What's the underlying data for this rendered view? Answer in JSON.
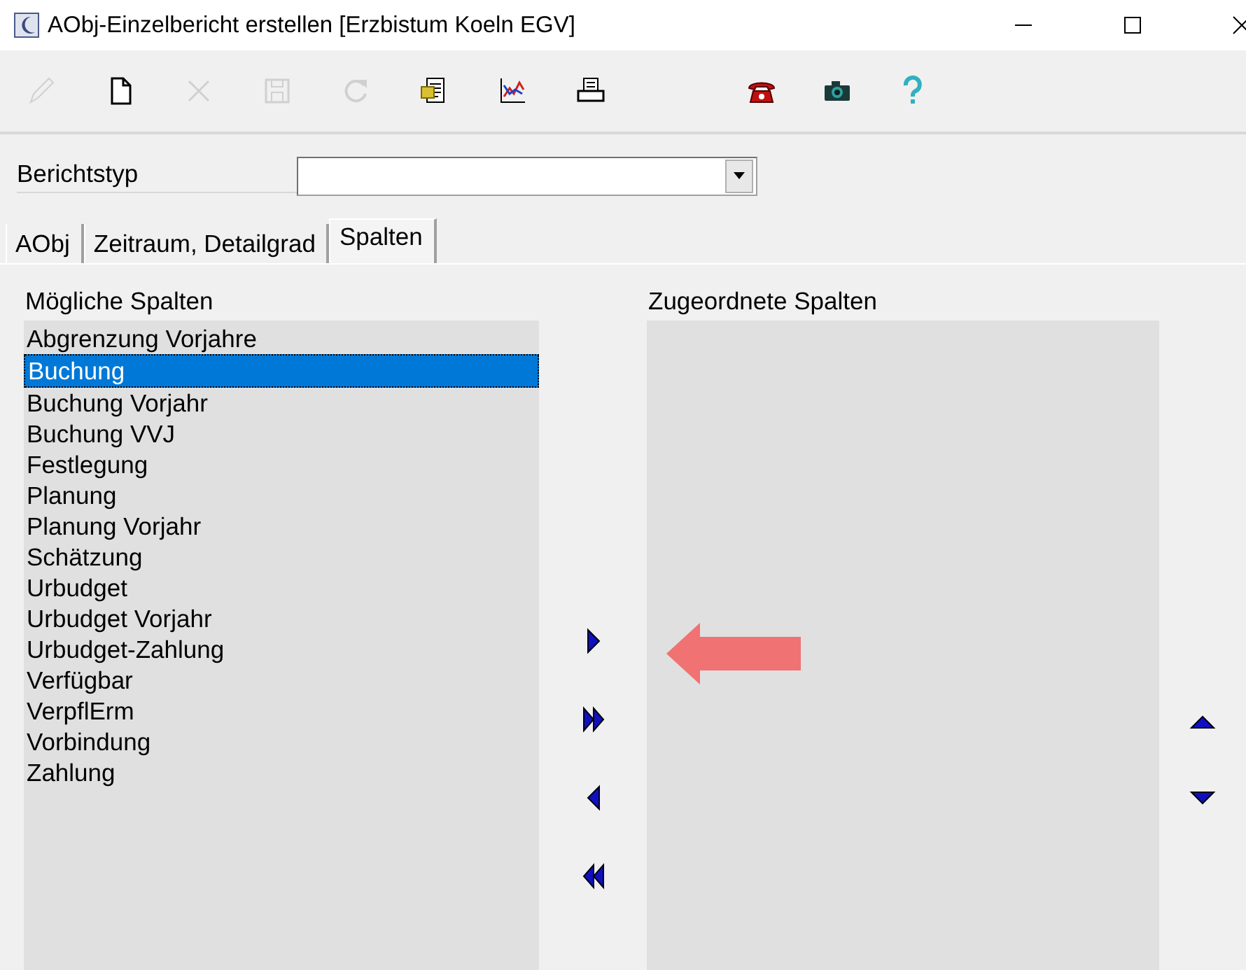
{
  "window": {
    "title": "AObj-Einzelbericht erstellen [Erzbistum Koeln EGV]"
  },
  "toolbar": [
    {
      "kind": "pencil",
      "disabled": true
    },
    {
      "kind": "new",
      "disabled": false
    },
    {
      "kind": "delete",
      "disabled": true
    },
    {
      "kind": "save",
      "disabled": true
    },
    {
      "kind": "refresh",
      "disabled": true
    },
    {
      "kind": "report",
      "disabled": false
    },
    {
      "kind": "chart",
      "disabled": false
    },
    {
      "kind": "print",
      "disabled": false
    }
  ],
  "toolbar_right": [
    {
      "kind": "phone",
      "disabled": false
    },
    {
      "kind": "camera",
      "disabled": false
    },
    {
      "kind": "help",
      "disabled": false
    }
  ],
  "report_type": {
    "label": "Berichtstyp"
  },
  "tabs": [
    {
      "label": "AObj",
      "selected": false
    },
    {
      "label": "Zeitraum, Detailgrad",
      "selected": false
    },
    {
      "label": "Spalten",
      "selected": true
    }
  ],
  "available": {
    "label": "Mögliche Spalten",
    "items": [
      {
        "label": "Abgrenzung Vorjahre",
        "selected": false
      },
      {
        "label": "Buchung",
        "selected": true
      },
      {
        "label": "Buchung Vorjahr",
        "selected": false
      },
      {
        "label": "Buchung VVJ",
        "selected": false
      },
      {
        "label": "Festlegung",
        "selected": false
      },
      {
        "label": "Planung",
        "selected": false
      },
      {
        "label": "Planung Vorjahr",
        "selected": false
      },
      {
        "label": "Schätzung",
        "selected": false
      },
      {
        "label": "Urbudget",
        "selected": false
      },
      {
        "label": "Urbudget Vorjahr",
        "selected": false
      },
      {
        "label": "Urbudget-Zahlung",
        "selected": false
      },
      {
        "label": "Verfügbar",
        "selected": false
      },
      {
        "label": "VerpflErm",
        "selected": false
      },
      {
        "label": "Vorbindung",
        "selected": false
      },
      {
        "label": "Zahlung",
        "selected": false
      }
    ]
  },
  "move_buttons": [
    {
      "kind": "add"
    },
    {
      "kind": "add-all"
    },
    {
      "kind": "remove"
    },
    {
      "kind": "remove-all"
    }
  ],
  "assigned": {
    "label": "Zugeordnete Spalten"
  },
  "order_buttons": [
    {
      "kind": "up"
    },
    {
      "kind": "down"
    }
  ]
}
